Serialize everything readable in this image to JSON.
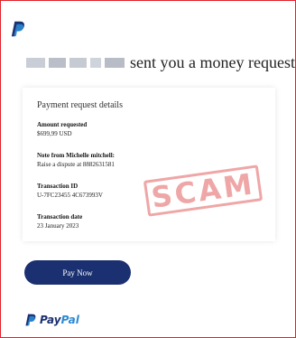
{
  "email": {
    "headline": "sent you a money request",
    "card": {
      "title": "Payment request details",
      "fields": [
        {
          "label": "Amount requested",
          "value": "$699,99 USD"
        },
        {
          "label": "Note from Michelle mitchell:",
          "value": "Raise a dispute at 8882631581"
        },
        {
          "label": "Transaction ID",
          "value": "U-7FC23455 4C673993V"
        },
        {
          "label": "Transaction date",
          "value": "23 January 2023"
        }
      ]
    },
    "stamp": "SCAM",
    "button_label": "Pay Now",
    "footer": {
      "wordmark_part1": "Pay",
      "wordmark_part2": "Pal"
    }
  },
  "colors": {
    "frame_border": "#e0222a",
    "button_bg": "#1b3070",
    "paypal_dark": "#1b3070",
    "paypal_light": "#2c8ad3",
    "stamp": "#e25c5c"
  },
  "icons": {
    "top_logo": "paypal-p-logo-icon",
    "footer_logo": "paypal-p-logo-icon"
  }
}
